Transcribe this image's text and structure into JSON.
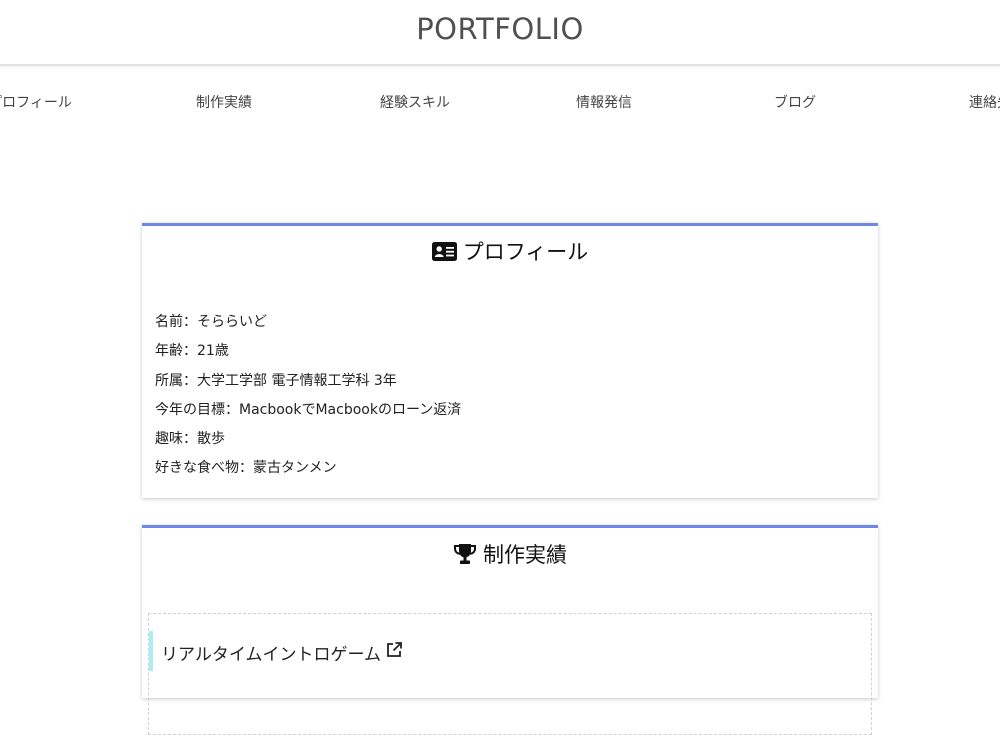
{
  "header": {
    "title": "PORTFOLIO"
  },
  "nav": {
    "items": [
      {
        "label": "プロフィール"
      },
      {
        "label": "制作実績"
      },
      {
        "label": "経験スキル"
      },
      {
        "label": "情報発信"
      },
      {
        "label": "ブログ"
      },
      {
        "label": "連絡先"
      }
    ]
  },
  "profile": {
    "title": "プロフィール",
    "icon": "id-card-icon",
    "rows": [
      "名前：そららいど",
      "年齢：21歳",
      "所属：大学工学部 電子情報工学科 3年",
      "今年の目標：MacbookでMacbookのローン返済",
      "趣味：散歩",
      "好きな食べ物：蒙古タンメン"
    ]
  },
  "works": {
    "title": "制作実績",
    "icon": "trophy-icon",
    "items": [
      {
        "label": "リアルタイムイントロゲーム",
        "icon": "external-link-icon"
      }
    ]
  },
  "colors": {
    "card_accent": "#6d87e8",
    "work_bar": "#a7eef5"
  }
}
